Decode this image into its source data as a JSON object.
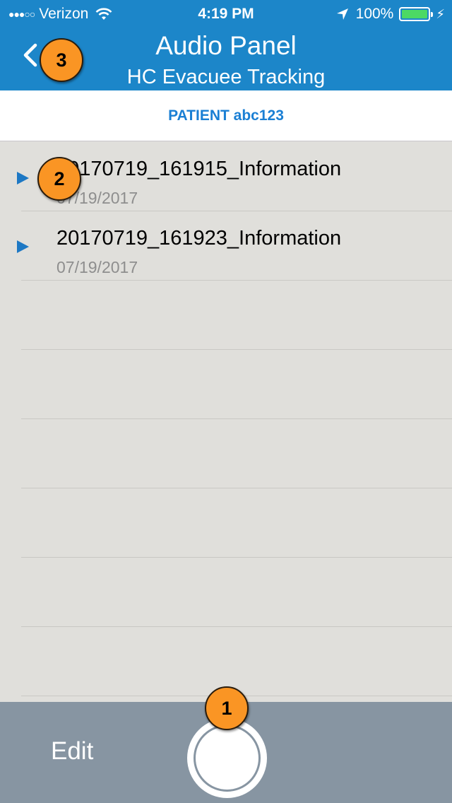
{
  "status_bar": {
    "signal": "●●●○○",
    "carrier": "Verizon",
    "time": "4:19 PM",
    "battery": "100%",
    "battery_level": 1.0,
    "icons": [
      "wifi-icon",
      "location-arrow-icon",
      "battery-icon",
      "charging-bolt-icon"
    ]
  },
  "nav": {
    "title": "Audio Panel",
    "subtitle": "HC Evacuee Tracking",
    "back_icon": "chevron-left-icon"
  },
  "patient_label": "PATIENT abc123",
  "recordings": [
    {
      "name": "20170719_161915_Information",
      "date": "07/19/2017"
    },
    {
      "name": "20170719_161923_Information",
      "date": "07/19/2017"
    }
  ],
  "toolbar": {
    "edit_label": "Edit",
    "record_icon": "record-button-icon"
  },
  "annotations": [
    "1",
    "2",
    "3"
  ],
  "colors": {
    "nav_bar": "#1c86c9",
    "accent": "#1a7fd4",
    "list_bg": "#e0dfdb",
    "toolbar": "#8795a2",
    "badge": "#fa9524",
    "battery_fill": "#4cd964"
  }
}
